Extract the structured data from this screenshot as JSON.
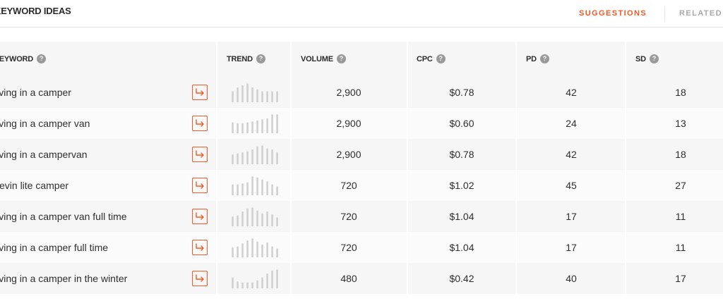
{
  "header": {
    "title": "KEYWORD IDEAS",
    "tabs": [
      {
        "label": "SUGGESTIONS",
        "active": true
      },
      {
        "label": "RELATED",
        "active": false
      }
    ]
  },
  "table": {
    "columns": [
      {
        "label": "KEYWORD",
        "help": "?"
      },
      {
        "label": "TREND",
        "help": "?"
      },
      {
        "label": "VOLUME",
        "help": "?"
      },
      {
        "label": "CPC",
        "help": "?"
      },
      {
        "label": "PD",
        "help": "?"
      },
      {
        "label": "SD",
        "help": "?"
      }
    ],
    "rows": [
      {
        "keyword": "living in a camper",
        "volume": "2,900",
        "cpc": "$0.78",
        "pd": "42",
        "sd": "18",
        "trend": [
          0.55,
          0.75,
          0.85,
          0.95,
          0.75,
          0.65,
          0.55,
          0.55,
          0.55,
          0.55
        ]
      },
      {
        "keyword": "living in a camper van",
        "volume": "2,900",
        "cpc": "$0.60",
        "pd": "24",
        "sd": "13",
        "trend": [
          0.55,
          0.5,
          0.5,
          0.55,
          0.6,
          0.65,
          0.7,
          0.75,
          0.95,
          0.95
        ]
      },
      {
        "keyword": "living in a campervan",
        "volume": "2,900",
        "cpc": "$0.78",
        "pd": "42",
        "sd": "18",
        "trend": [
          0.5,
          0.55,
          0.6,
          0.65,
          0.75,
          0.9,
          0.95,
          0.8,
          0.75,
          0.6
        ]
      },
      {
        "keyword": "kevin lite camper",
        "volume": "720",
        "cpc": "$1.02",
        "pd": "45",
        "sd": "27",
        "trend": [
          0.55,
          0.55,
          0.6,
          0.65,
          0.95,
          0.9,
          0.8,
          0.7,
          0.55,
          0.45
        ]
      },
      {
        "keyword": "living in a camper van full time",
        "volume": "720",
        "cpc": "$1.04",
        "pd": "17",
        "sd": "11",
        "trend": [
          0.5,
          0.55,
          0.75,
          0.9,
          0.95,
          0.8,
          0.65,
          0.75,
          0.6,
          0.45
        ]
      },
      {
        "keyword": "living in a camper full time",
        "volume": "720",
        "cpc": "$1.04",
        "pd": "17",
        "sd": "11",
        "trend": [
          0.5,
          0.55,
          0.7,
          0.85,
          0.95,
          0.8,
          0.65,
          0.75,
          0.55,
          0.45
        ]
      },
      {
        "keyword": "living in a camper in the winter",
        "volume": "480",
        "cpc": "$0.42",
        "pd": "40",
        "sd": "17",
        "trend": [
          0.55,
          0.35,
          0.3,
          0.3,
          0.3,
          0.4,
          0.55,
          0.75,
          0.9,
          0.95
        ]
      }
    ]
  },
  "colors": {
    "accent": "#f15a24",
    "sd_highlight": "#d5fbee",
    "trend_bar": "#cfcfcf",
    "help_icon": "#9a9a9a"
  },
  "icons": {
    "row_action": "arrow-turn-right-icon",
    "help": "question-circle-icon"
  }
}
